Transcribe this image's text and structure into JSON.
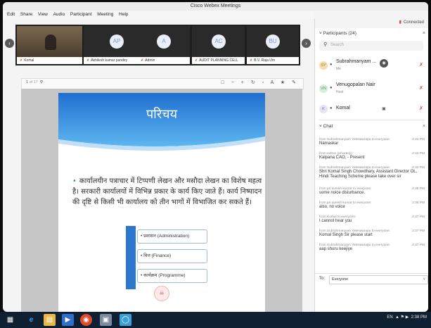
{
  "window": {
    "title": "Cisco Webex Meetings"
  },
  "menu": [
    "Edit",
    "Share",
    "View",
    "Audio",
    "Participant",
    "Meeting",
    "Help"
  ],
  "status": {
    "connected": "Connected"
  },
  "strip": {
    "tiles": [
      {
        "initials": "",
        "name": "Komal"
      },
      {
        "initials": "AP",
        "name": "Akhilesh kumar pandey"
      },
      {
        "initials": "A",
        "name": "Admin"
      },
      {
        "initials": "AC",
        "name": "AUDIT PLANNING CELL"
      },
      {
        "initials": "BU",
        "name": "B.V. Raja Um"
      }
    ]
  },
  "share": {
    "page_current": "1",
    "page_total": "of 17",
    "slide_heading": "परिचय",
    "bullet_text": "कार्यालयीन पत्राचार में टिप्पणी लेखन और मसौदा लेखन का विशेष महत्व है। सरकारी कार्यालयों में विभिन्न प्रकार के कार्य किए जाते हैं। कार्य निष्पादन की दृष्टि से किसी भी कार्यालय को तीन भागों में विभाजित कर सकते हैं।",
    "items": [
      "• प्रशासन (Administration)",
      "• वित्त (Finance)",
      "• कार्यक्रम (Programme)"
    ]
  },
  "participants": {
    "title": "Participants (24)",
    "search_placeholder": "Search",
    "list": [
      {
        "initials": "SY",
        "name": "Subrahmanyam ...",
        "role": "Me"
      },
      {
        "initials": "VN",
        "name": "Venugopalan Nair",
        "role": "Host"
      },
      {
        "initials": "K",
        "name": "Komal",
        "role": ""
      }
    ]
  },
  "chat": {
    "title": "Chat",
    "messages": [
      {
        "from": "from Subrahmanyam Yeleswarapu to everyone:",
        "time": "2:24 PM",
        "text": "Namaskar"
      },
      {
        "from": "from Admin (privately):",
        "time": "2:22 PM",
        "text": "Kalpana CAO, - Present"
      },
      {
        "from": "from Subrahmanyam Yeleswarapu to everyone:",
        "time": "2:32 PM",
        "text": "Shri Komal Singh Chowdhary, Assistant Director OL, Hindi Teaching Scheme please take over sir"
      },
      {
        "from": "from pri suresh kumar to everyone:",
        "time": "2:36 PM",
        "text": "some noice disturbance."
      },
      {
        "from": "from pri suresh kumar to everyone:",
        "time": "2:36 PM",
        "text": "also, no voice"
      },
      {
        "from": "from Komal to everyone:",
        "time": "2:37 PM",
        "text": "I cannot hear you"
      },
      {
        "from": "from Subrahmanyam Yeleswarapu to everyone:",
        "time": "2:37 PM",
        "text": "Komal Singh Sir please start"
      },
      {
        "from": "from Subrahmanyam Yeleswarapu to everyone:",
        "time": "2:37 PM",
        "text": "aap shuru keejiye"
      }
    ],
    "to_label": "To:",
    "to_value": "Everyone"
  },
  "taskbar": {
    "lang": "EN",
    "time": "2:38 PM"
  }
}
